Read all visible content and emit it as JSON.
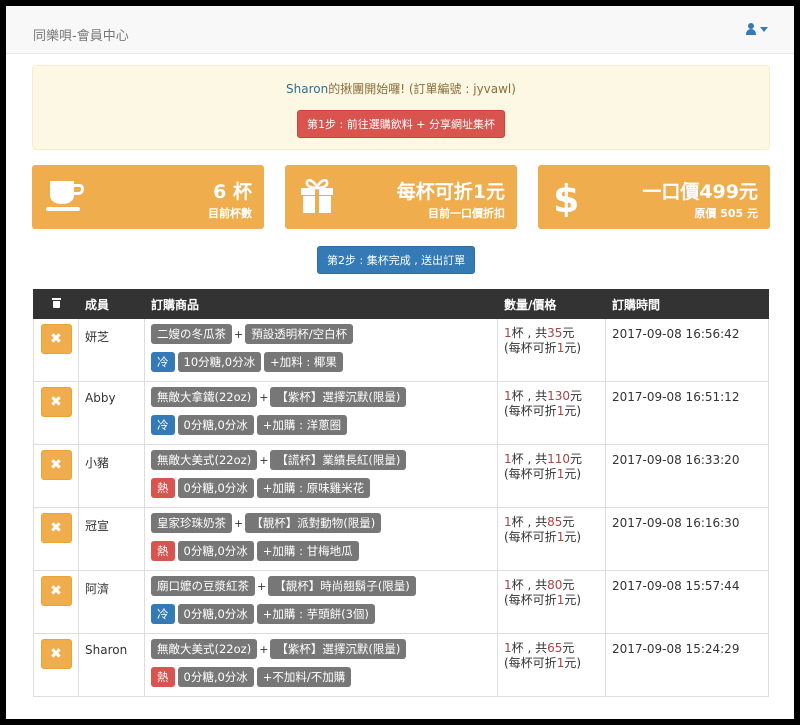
{
  "app": {
    "title": "同樂唄-會員中心"
  },
  "notice": {
    "owner": "Sharon",
    "text": "的揪團開始囉! (訂單編號 : jyvawl)",
    "step1_label": "第1步 : 前往選購飲料 + 分享網址集杯"
  },
  "stats": [
    {
      "icon": "coffee-cup-icon",
      "value": "6 杯",
      "label": "目前杯數"
    },
    {
      "icon": "gift-icon",
      "value": "每杯可折1元",
      "label": "目前一口價折扣"
    },
    {
      "icon": "dollar-icon",
      "value": "一口價499元",
      "label": "原價 505 元"
    }
  ],
  "step2_label": "第2步 : 集杯完成 , 送出訂單",
  "table": {
    "headers": {
      "member": "成員",
      "items": "訂購商品",
      "qty": "數量/價格",
      "time": "訂購時間"
    },
    "rows": [
      {
        "member": "妍芝",
        "drink": "二嫂の冬瓜茶",
        "option": "預設透明杯/空白杯",
        "temp": "冷",
        "temp_type": "cold",
        "sugar": "10分糖,0分冰",
        "addon": "+加料 : 椰果",
        "qty": "1",
        "price": "35",
        "discount": "1",
        "time": "2017-09-08 16:56:42"
      },
      {
        "member": "Abby",
        "drink": "無敵大拿鐵(22oz)",
        "option": "【紫杯】選擇沉默(限量)",
        "temp": "冷",
        "temp_type": "cold",
        "sugar": "0分糖,0分冰",
        "addon": "+加購 : 洋蔥圈",
        "qty": "1",
        "price": "130",
        "discount": "1",
        "time": "2017-09-08 16:51:12"
      },
      {
        "member": "小豬",
        "drink": "無敵大美式(22oz)",
        "option": "【謊杯】業績長紅(限量)",
        "temp": "熱",
        "temp_type": "hot",
        "sugar": "0分糖,0分冰",
        "addon": "+加購 : 原味雞米花",
        "qty": "1",
        "price": "110",
        "discount": "1",
        "time": "2017-09-08 16:33:20"
      },
      {
        "member": "冠宣",
        "drink": "皇家珍珠奶茶",
        "option": "【靚杯】派對動物(限量)",
        "temp": "熱",
        "temp_type": "hot",
        "sugar": "0分糖,0分冰",
        "addon": "+加購 : 甘梅地瓜",
        "qty": "1",
        "price": "85",
        "discount": "1",
        "time": "2017-09-08 16:16:30"
      },
      {
        "member": "阿濟",
        "drink": "廟口嬤の豆漿紅茶",
        "option": "【靚杯】時尚翹鬍子(限量)",
        "temp": "冷",
        "temp_type": "cold",
        "sugar": "0分糖,0分冰",
        "addon": "+加購 : 芋頭餅(3個)",
        "qty": "1",
        "price": "80",
        "discount": "1",
        "time": "2017-09-08 15:57:44"
      },
      {
        "member": "Sharon",
        "drink": "無敵大美式(22oz)",
        "option": "【紫杯】選擇沉默(限量)",
        "temp": "熱",
        "temp_type": "hot",
        "sugar": "0分糖,0分冰",
        "addon": "+不加料/不加購",
        "qty": "1",
        "price": "65",
        "discount": "1",
        "time": "2017-09-08 15:24:29"
      }
    ]
  }
}
